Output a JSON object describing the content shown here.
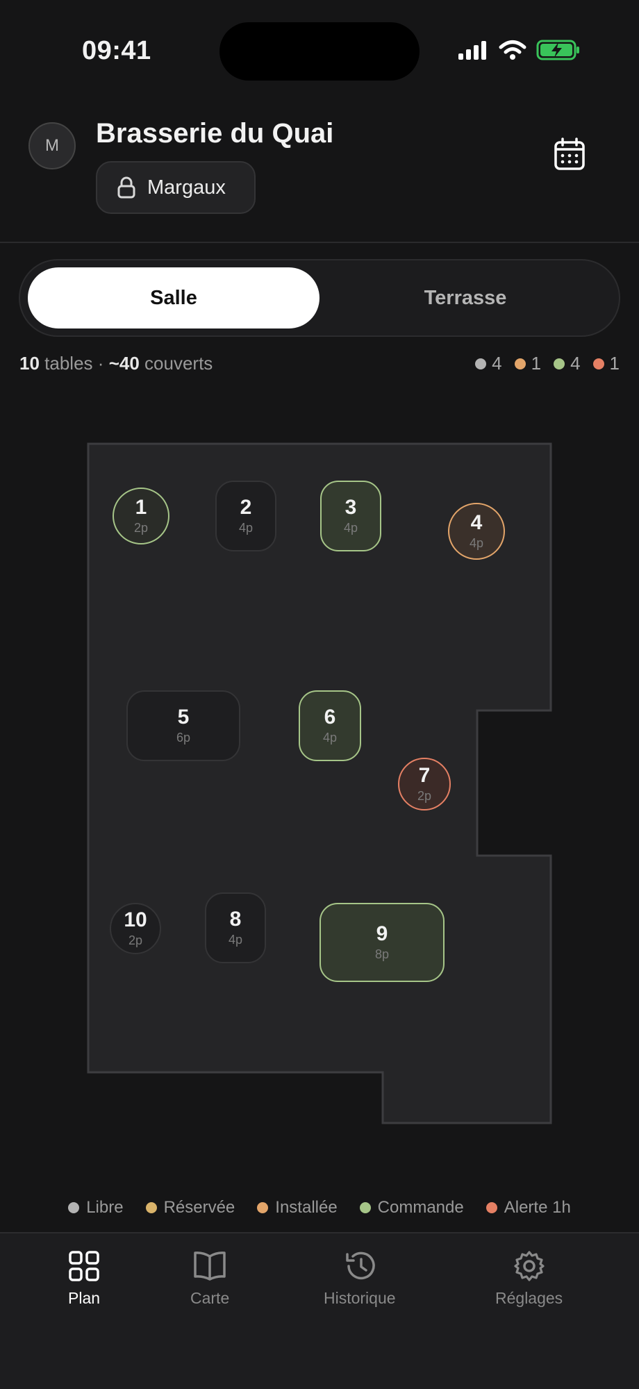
{
  "status_bar": {
    "time": "09:41"
  },
  "header": {
    "avatar_initial": "M",
    "venue_name": "Brasserie du Quai",
    "user_name": "Margaux"
  },
  "segments": {
    "active": "Salle",
    "inactive": "Terrasse"
  },
  "summary": {
    "tables_count": "10",
    "tables_label": "tables",
    "separator": "·",
    "covers": "~40",
    "covers_label": "couverts"
  },
  "status_counts": [
    {
      "status": "Libre",
      "count": "4",
      "color": "#b3b3b3"
    },
    {
      "status": "Installée",
      "count": "1",
      "color": "#e3a56a"
    },
    {
      "status": "Commande",
      "count": "4",
      "color": "#a6c588"
    },
    {
      "status": "Alerte 1h",
      "count": "1",
      "color": "#e58064"
    }
  ],
  "tables": [
    {
      "number": "1",
      "capacity": "2p",
      "status": "commande"
    },
    {
      "number": "2",
      "capacity": "4p",
      "status": "libre"
    },
    {
      "number": "3",
      "capacity": "4p",
      "status": "commande"
    },
    {
      "number": "4",
      "capacity": "4p",
      "status": "installee"
    },
    {
      "number": "5",
      "capacity": "6p",
      "status": "libre"
    },
    {
      "number": "6",
      "capacity": "4p",
      "status": "commande"
    },
    {
      "number": "7",
      "capacity": "2p",
      "status": "alerte"
    },
    {
      "number": "8",
      "capacity": "4p",
      "status": "libre"
    },
    {
      "number": "9",
      "capacity": "8p",
      "status": "commande"
    },
    {
      "number": "10",
      "capacity": "2p",
      "status": "libre"
    }
  ],
  "legend": [
    {
      "label": "Libre",
      "color": "#b3b3b3"
    },
    {
      "label": "Réservée",
      "color": "#d9b36a"
    },
    {
      "label": "Installée",
      "color": "#e3a56a"
    },
    {
      "label": "Commande",
      "color": "#a6c588"
    },
    {
      "label": "Alerte 1h",
      "color": "#e58064"
    }
  ],
  "tabs": [
    {
      "label": "Plan",
      "icon": "grid-icon",
      "active": true
    },
    {
      "label": "Carte",
      "icon": "book-icon",
      "active": false
    },
    {
      "label": "Historique",
      "icon": "history-icon",
      "active": false
    },
    {
      "label": "Réglages",
      "icon": "gear-icon",
      "active": false
    }
  ]
}
